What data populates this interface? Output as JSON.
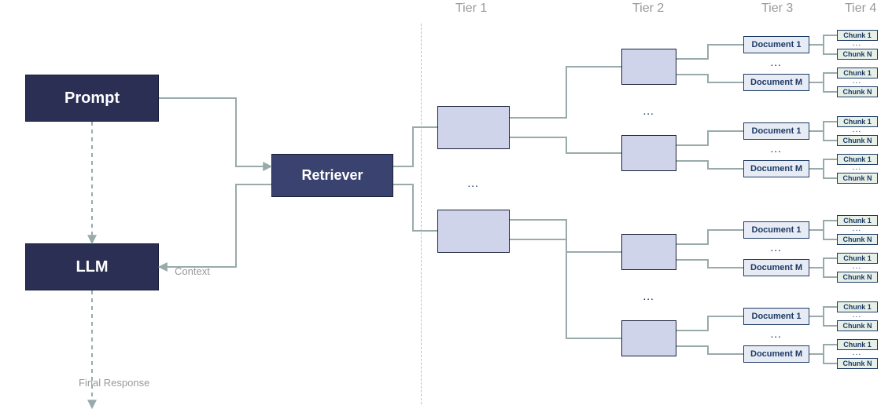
{
  "tiers": {
    "t1": "Tier 1",
    "t2": "Tier 2",
    "t3": "Tier 3",
    "t4": "Tier 4"
  },
  "nodes": {
    "prompt": "Prompt",
    "llm": "LLM",
    "retriever": "Retriever",
    "response": "Final Response",
    "context": "Context",
    "doc1": "Document 1",
    "docM": "Document M",
    "chunk1": "Chunk 1",
    "chunkN": "Chunk N"
  },
  "dots": "..."
}
